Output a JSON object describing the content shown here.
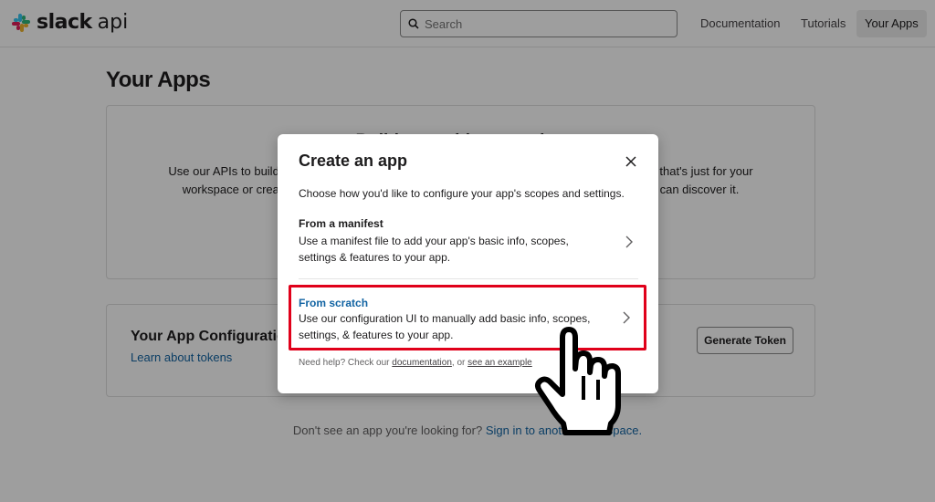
{
  "header": {
    "brand": "slack",
    "api": "api",
    "search_placeholder": "Search",
    "nav": [
      "Documentation",
      "Tutorials",
      "Your Apps"
    ],
    "active_nav": "Your Apps"
  },
  "page": {
    "title": "Your Apps",
    "build_card": {
      "heading": "Build something amazing",
      "text": "Use our APIs to build an app that makes people's working lives better. You can create an app that's just for your workspace or create a public Slack App to list in the App Directory, where anyone on Slack can discover it."
    },
    "config_card": {
      "title": "Your App Configuration Tokens",
      "link": "Learn about tokens",
      "button": "Generate Token"
    },
    "footer": {
      "text": "Don't see an app you're looking for?",
      "link": "Sign in to another workspace."
    }
  },
  "modal": {
    "title": "Create an app",
    "subtitle": "Choose how you'd like to configure your app's scopes and settings.",
    "options": [
      {
        "title": "From a manifest",
        "line1": "Use a manifest file to add your app's basic info, scopes,",
        "line2": "settings & features to your app."
      },
      {
        "title": "From scratch",
        "line1": "Use our configuration UI to manually add basic info, scopes,",
        "line2": "settings, & features to your app."
      }
    ],
    "help": {
      "prefix": "Need help? Check our",
      "doc_link": "documentation",
      "middle": ", or",
      "example_link": "see an example"
    }
  },
  "colors": {
    "link": "#1264a3",
    "highlight_border": "#e0001a",
    "overlay": "rgba(0,0,0,0.38)"
  },
  "icons": [
    "slack-logo-icon",
    "search-icon",
    "close-icon",
    "chevron-right-icon",
    "hand-pointer-cursor-icon"
  ]
}
